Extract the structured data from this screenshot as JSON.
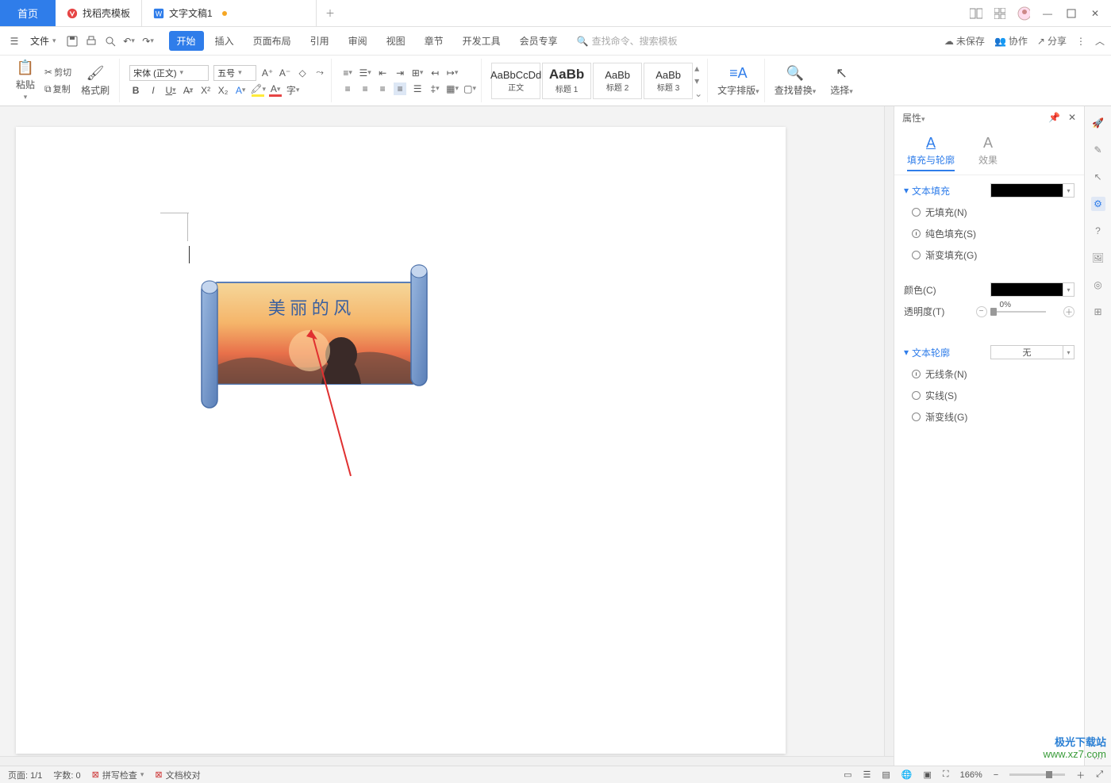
{
  "titlebar": {
    "home": "首页",
    "tab_template": "找稻壳模板",
    "tab_doc": "文字文稿1"
  },
  "menubar": {
    "file": "文件",
    "search_placeholder": "查找命令、搜索模板",
    "items": {
      "start": "开始",
      "insert": "插入",
      "layout": "页面布局",
      "refer": "引用",
      "review": "审阅",
      "view": "视图",
      "chapter": "章节",
      "dev": "开发工具",
      "member": "会员专享"
    },
    "unsaved": "未保存",
    "coop": "协作",
    "share": "分享"
  },
  "ribbon": {
    "paste": "粘贴",
    "cut": "剪切",
    "copy": "复制",
    "format": "格式刷",
    "font": "宋体 (正文)",
    "size": "五号",
    "style_body_preview": "AaBbCcDd",
    "style_body": "正文",
    "style_h_preview": "AaBb",
    "style_h1": "标题 1",
    "style_h2": "标题 2",
    "style_h3": "标题 3",
    "layout": "文字排版",
    "findrep": "查找替换",
    "select": "选择"
  },
  "canvas": {
    "shape_text": "美 丽 的 风"
  },
  "panel": {
    "title": "属性",
    "tab_fill": "填充与轮廓",
    "tab_effect": "效果",
    "sec_textfill": "文本填充",
    "fill_none": "无填充(N)",
    "fill_solid": "纯色填充(S)",
    "fill_grad": "渐变填充(G)",
    "color": "颜色(C)",
    "opacity": "透明度(T)",
    "opacity_val": "0%",
    "sec_outline": "文本轮廓",
    "outline_value": "无",
    "line_none": "无线条(N)",
    "line_solid": "实线(S)",
    "line_grad": "渐变线(G)"
  },
  "status": {
    "page": "页面: 1/1",
    "words": "字数: 0",
    "spell": "拼写检查",
    "proof": "文档校对",
    "zoom": "166%"
  },
  "watermark": {
    "l1": "极光下载站",
    "l2": "www.xz7.com"
  }
}
